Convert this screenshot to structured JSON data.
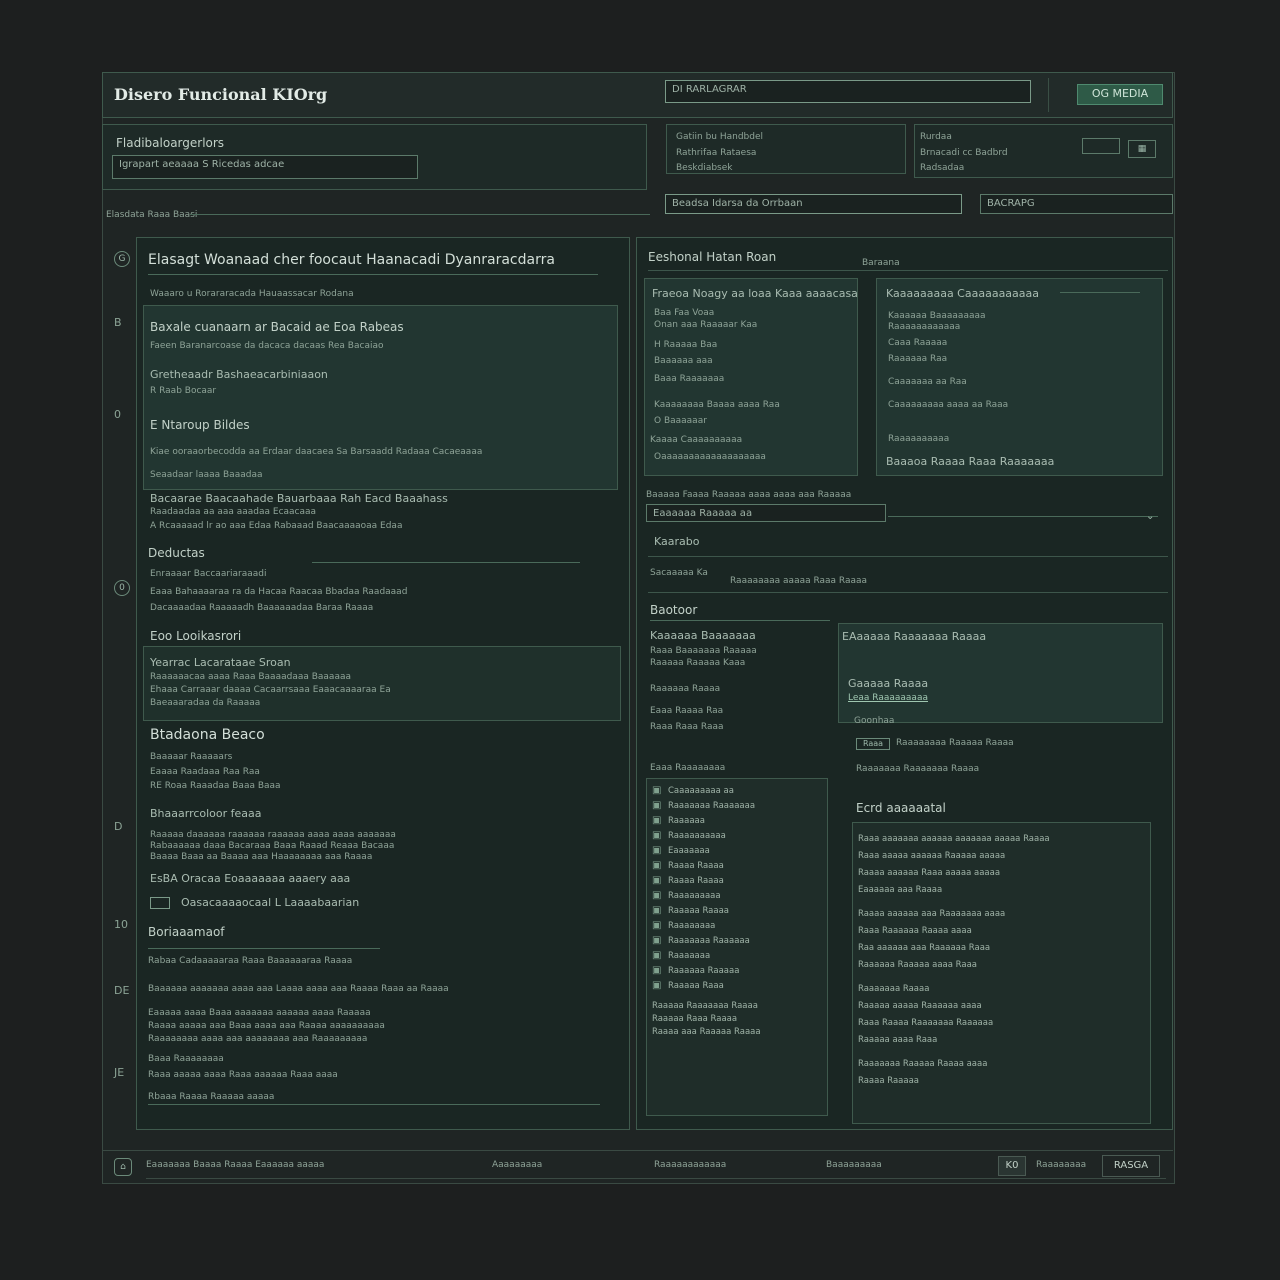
{
  "app": {
    "title": "Disero Funcional KIOrg",
    "search_placeholder": "DI RARLAGRAR",
    "primary_button": "OG MEDIA"
  },
  "filters": {
    "label": "Fladibaloargerlors",
    "field_value": "Igrapart aeaaaa S Ricedas adcae",
    "right_block_1": [
      "Gatiin bu Handbdel",
      "Rathrifaa Rataesa",
      "Beskdiabsek"
    ],
    "right_block_2": [
      "Rurdaa",
      "Brnacadi cc Badbrd",
      "Radsadaa"
    ],
    "breadcrumb": "Elasdata Raaa Baasi",
    "select_1": "Beadsa Idarsa da Orrbaan",
    "select_2": "BACRAPG"
  },
  "left_panel": {
    "heading": "Elasagt Woanaad cher foocaut Haanacadi Dyanraracdarra",
    "subline": "Waaaro u Rorararacada Hauaassacar Rodana",
    "card": {
      "line1": "Baxale cuanaarn ar Bacaid ae Eoa Rabeas",
      "line2": "Faeen Baranarcoase da dacaca dacaas Rea Bacaiao",
      "line3": "Gretheaadr Bashaeacarbiniaaon",
      "line4": "R Raab Bocaar",
      "head2": "E Ntaroup Bildes",
      "para1": "Kiae ooraaorbecodda aa Erdaar daacaea Sa Barsaadd Radaaa Cacaeaaaa",
      "para2": "Seaadaar laaaa Baaadaa",
      "para3": "Bacaarae Baacaahade Bauarbaaa Rah Eacd Baaahass",
      "para4": "Raadaadaa aa aaa aaadaa Ecaacaaa",
      "para5": "A Rcaaaaad lr ao aaa Edaa Rabaaad Baacaaaaoaa Edaa"
    },
    "sec_deductas": "Deductas",
    "deductas_line": "Enraaaar Baccaariaraaadi",
    "deductas_rows": [
      "Eaaa Bahaaaaraa ra da Hacaa Raacaa Bbadaa Raadaaad",
      "Dacaaaadaa Raaaaadh Baaaaaadaa Baraa Raaaa"
    ],
    "sec_booklet": "Eoo Looikasrori",
    "booklet_head": "Yearrac Lacarataae Sroan",
    "booklet_rows": [
      "Raaaaaacaa aaaa Raaa Baaaadaaa Baaaaaa",
      "Ehaaa Carraaar daaaa Cacaarrsaaa Eaaacaaaaraa Ea",
      "Baeaaaradaa da Raaaaa"
    ],
    "sub_head": "Btadaona Beaco",
    "sub_rows": [
      "Baaaaar Raaaaars",
      "Eaaaa Raadaaa Raa Raa",
      "RE Roaa Raaadaa Baaa Baaa"
    ],
    "section_c": "Bhaaarrcoloor feaaa",
    "c_rows": [
      "Raaaaa daaaaaa raaaaaa raaaaaa aaaa aaaa aaaaaaa",
      "Rabaaaaaa daaa Bacaraaa Baaa Raaad Reaaa Bacaaa",
      "Baaaa Baaa aa Baaaa aaa Haaaaaaaa aaa Raaaa"
    ],
    "c_footer": "EsBA Oracaa Eoaaaaaaa aaaery aaa",
    "checkbox_label": "Oasacaaaaocaal L Laaaabaarian",
    "section_d": "Boriaaamaof",
    "d_rows": [
      "Rabaa Cadaaaaaraa Raaa Baaaaaaraa Raaaa",
      "Baaaaaa aaaaaaa aaaa aaa Laaaa aaaa aaa Raaaa Raaa aa Raaaa",
      "Eaaaaa aaaa Baaa aaaaaaa aaaaaa aaaa Raaaaa",
      "Raaaa aaaaa aaa Baaa aaaa aaa Raaaa aaaaaaaaaa",
      "Raaaaaaaa aaaa aaa aaaaaaaa aaa Raaaaaaaaa",
      "Baaa Raaaaaaaa",
      "Raaa aaaaa aaaa Raaa aaaaaa Raaa aaaa",
      "Rbaaa Raaaa Raaaaa aaaaa"
    ]
  },
  "right_panel": {
    "heading": "Eeshonal Hatan Roan",
    "heading_right": "Baraana",
    "card_a": {
      "title": "Fraeoa Noagy aa loaa Kaaa aaaacasa",
      "rows": [
        "Baa Faa Voaa",
        "Onan aaa Raaaaar Kaa",
        "H Raaaaa Baa",
        "Baaaaaa aaa",
        "Baaa Raaaaaaa",
        "Kaaaaaaaa Baaaa aaaa Raa",
        "O Baaaaaar",
        "Kaaaa Caaaaaaaaaa",
        "Oaaaaaaaaaaaaaaaaaaa"
      ]
    },
    "card_b": {
      "title": "Kaaaaaaaaa Caaaaaaaaaaa",
      "rows": [
        "Kaaaaaa Baaaaaaaaa",
        "Raaaaaaaaaaaa",
        "Caaa Raaaaa",
        "Raaaaaa Raa",
        "Caaaaaaa aa Raa",
        "Caaaaaaaaa aaaa aa Raaa",
        "Raaaaaaaaaa",
        "Baaaoa Raaaa Raaa Raaaaaaa"
      ]
    },
    "strip_text": "Baaaaa Faaaa Raaaaa aaaa aaaa aaa Raaaaa",
    "strip_val": "Eaaaaaa Raaaaa aa",
    "search_label": "Kaarabo",
    "results": "Sacaaaaa Ka",
    "results_right": "Raaaaaaaa aaaaa Raaa Raaaa",
    "section_label": "Baotoor",
    "lower_left_title": "Kaaaaaa Baaaaaaa",
    "lower_left_rows": [
      "Raaa Baaaaaaa Raaaaa",
      "Raaaaa Raaaaa Kaaa",
      "Raaaaaa Raaaa",
      "Eaaa Raaaa Raa",
      "Raaa Raaa Raaa"
    ],
    "list_head": "Eaaa Raaaaaaaa",
    "list_items": [
      "Caaaaaaaaa aa",
      "Raaaaaaa Raaaaaaa",
      "Raaaaaa",
      "Raaaaaaaaaa",
      "Eaaaaaaa",
      "Raaaa Raaaa",
      "Raaaa Raaaa",
      "Raaaaaaaaa",
      "Raaaaa Raaaa",
      "Raaaaaaaa",
      "Raaaaaaa Raaaaaa",
      "Raaaaaaa",
      "Raaaaaa Raaaaa",
      "Raaaaa Raaa"
    ],
    "list_footer": [
      "Raaaaa Raaaaaaa Raaaa",
      "Raaaaa Raaa Raaaa",
      "Raaaa aaa Raaaaa Raaaa"
    ],
    "card_c_title": "EAaaaaa Raaaaaaa Raaaa",
    "card_c_sub": "Gaaaaa Raaaa",
    "card_c_link": "Leaa Raaaaaaaaa",
    "card_c_footer": "Goonhaa",
    "card_c_chip": "Raaa",
    "card_c_rows": [
      "Raaaaaaaa Raaaaa Raaaa",
      "Raaaaaaa Raaaaaaa Raaaa"
    ],
    "detail_title": "Ecrd aaaaaatal",
    "detail_rows": [
      "Raaa aaaaaaa aaaaaa aaaaaaa aaaaa Raaaa",
      "Raaa aaaaa aaaaaa Raaaaa aaaaa",
      "Raaaa aaaaaa Raaa aaaaa aaaaa",
      "Eaaaaaa aaa Raaaa",
      "Raaaa aaaaaa aaa Raaaaaaa aaaa",
      "Raaa Raaaaaa Raaaa aaaa",
      "Raa aaaaaa aaa Raaaaaa Raaa",
      "Raaaaaa Raaaaa aaaa Raaa",
      "Raaaaaaa Raaaa",
      "Raaaaa aaaaa Raaaaaa aaaa",
      "Raaa Raaaa Raaaaaaa Raaaaaa",
      "Raaaaa aaaa Raaa",
      "Raaaaaaa Raaaaa Raaaa aaaa",
      "Raaaa Raaaaa"
    ]
  },
  "footer": {
    "left": "Eaaaaaaa Baaaa Raaaa Eaaaaaa aaaaa",
    "mid1": "Aaaaaaaaa",
    "mid2": "Raaaaaaaaaaaa",
    "mid3": "Baaaaaaaaa",
    "page": "K0",
    "right": "Raaaaaaaa",
    "badge": "RASGA"
  },
  "gutter": [
    "G",
    "B",
    "0",
    "0",
    "D",
    "10",
    "DE",
    "JE"
  ]
}
